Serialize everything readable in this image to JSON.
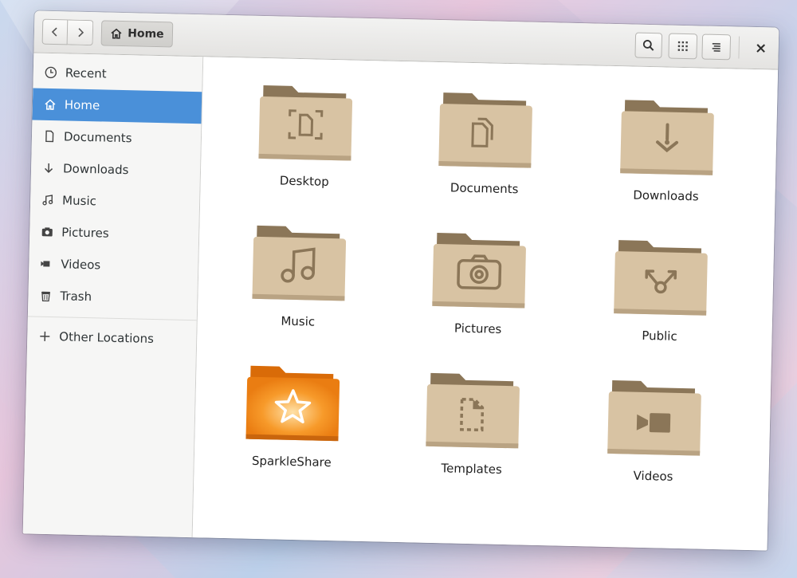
{
  "header": {
    "back_icon": "chevron-left-icon",
    "forward_icon": "chevron-right-icon",
    "path_label": "Home",
    "close_glyph": "×"
  },
  "sidebar": {
    "items": [
      {
        "label": "Recent",
        "icon": "clock-icon"
      },
      {
        "label": "Home",
        "icon": "home-icon",
        "selected": true
      },
      {
        "label": "Documents",
        "icon": "document-icon"
      },
      {
        "label": "Downloads",
        "icon": "download-arrow-icon"
      },
      {
        "label": "Music",
        "icon": "music-note-icon"
      },
      {
        "label": "Pictures",
        "icon": "camera-icon"
      },
      {
        "label": "Videos",
        "icon": "video-camera-icon"
      },
      {
        "label": "Trash",
        "icon": "trash-icon"
      }
    ],
    "other_locations": {
      "label": "Other Locations",
      "icon": "plus-icon"
    }
  },
  "folders": [
    {
      "label": "Desktop",
      "emblem": "desktop-emblem"
    },
    {
      "label": "Documents",
      "emblem": "documents-emblem"
    },
    {
      "label": "Downloads",
      "emblem": "downloads-emblem"
    },
    {
      "label": "Music",
      "emblem": "music-emblem"
    },
    {
      "label": "Pictures",
      "emblem": "camera-emblem"
    },
    {
      "label": "Public",
      "emblem": "share-emblem"
    },
    {
      "label": "SparkleShare",
      "emblem": "star-emblem"
    },
    {
      "label": "Templates",
      "emblem": "template-emblem"
    },
    {
      "label": "Videos",
      "emblem": "video-emblem"
    }
  ],
  "colors": {
    "folder_beige": "#d8c3a3",
    "folder_tab": "#8b7658",
    "folder_orange": "#f08a1c",
    "accent": "#4a90d9"
  }
}
